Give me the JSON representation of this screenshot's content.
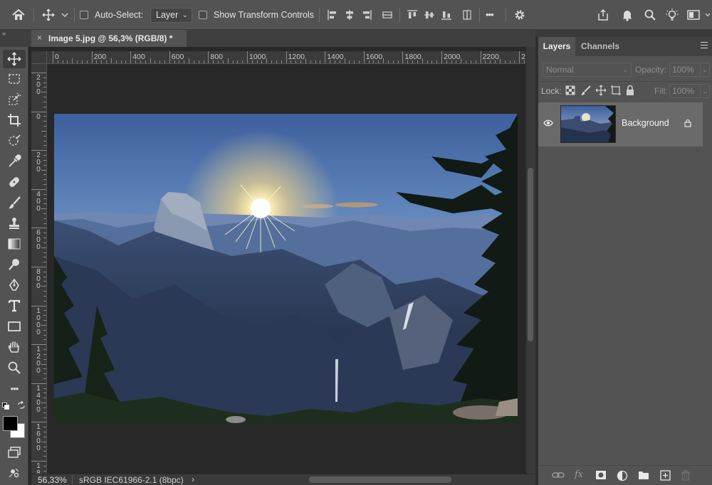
{
  "options_bar": {
    "auto_select_label": "Auto-Select:",
    "auto_select_target": "Layer",
    "show_transform_label": "Show Transform Controls",
    "more_glyph": "•••"
  },
  "document": {
    "tab_title": "Image 5.jpg @ 56,3% (RGB/8) *",
    "close_glyph": "×",
    "collapse_glyph": "»"
  },
  "rulers": {
    "top_labels": [
      "0",
      "200",
      "400",
      "600",
      "800",
      "1000",
      "1200",
      "1400",
      "1600",
      "1800",
      "2000",
      "2200",
      "24"
    ],
    "left_labels": [
      "200",
      "0",
      "200",
      "400",
      "600",
      "800",
      "1000",
      "1200",
      "1400",
      "1600",
      "1800"
    ]
  },
  "toolbar": {
    "more_tools_glyph": "•••"
  },
  "status": {
    "zoom": "56,33%",
    "doc_info": "sRGB IEC61966-2.1 (8bpc)",
    "arrow": "›"
  },
  "layers_panel": {
    "tabs": [
      "Layers",
      "Channels"
    ],
    "blend_mode": "Normal",
    "opacity_label": "Opacity:",
    "opacity_value": "100%",
    "lock_label": "Lock:",
    "fill_label": "Fill:",
    "fill_value": "100%",
    "layers": [
      {
        "name": "Background",
        "visible": true,
        "locked": true
      }
    ]
  },
  "colors": {
    "accent": "#535353",
    "canvas_bg": "#282828",
    "panel_bg": "#535353",
    "selected_layer": "#6a6a6a"
  },
  "icons": [
    "home-icon",
    "move-icon",
    "align-left-icon",
    "align-center-icon",
    "align-right-icon",
    "distribute-icon",
    "gear-icon",
    "share-icon",
    "bell-icon",
    "search-icon",
    "lightbulb-icon",
    "workspace-icon",
    "marquee-icon",
    "lasso-icon",
    "crop-icon",
    "object-select-icon",
    "eyedropper-icon",
    "healing-icon",
    "brush-icon",
    "stamp-icon",
    "gradient-icon",
    "dodge-icon",
    "pen-icon",
    "type-icon",
    "rectangle-icon",
    "hand-icon",
    "zoom-icon",
    "eye-icon",
    "lock-icon",
    "link-icon",
    "fx-icon",
    "mask-icon",
    "adjustment-icon",
    "folder-icon",
    "new-layer-icon",
    "trash-icon"
  ]
}
